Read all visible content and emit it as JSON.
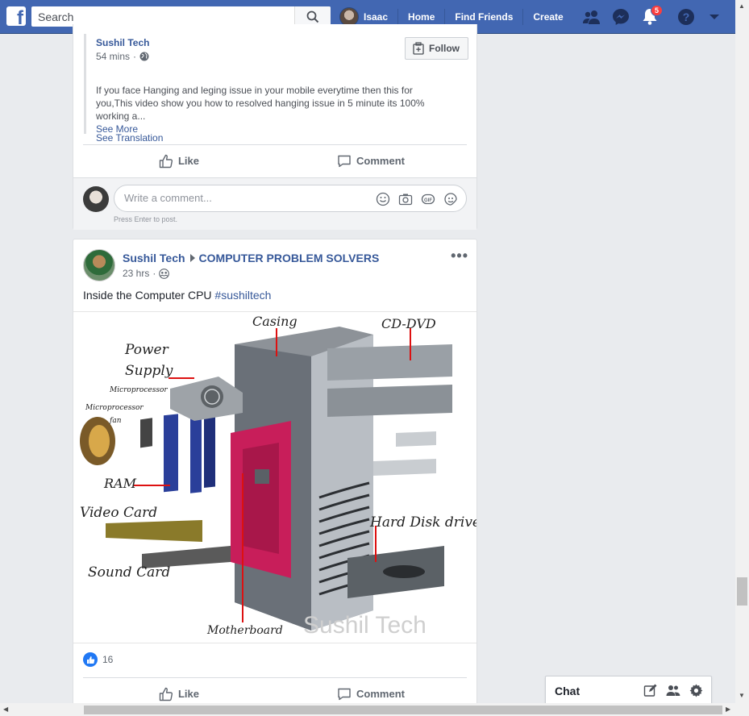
{
  "topbar": {
    "logo": "f",
    "search_placeholder": "Search",
    "user_name": "Isaac",
    "nav_home": "Home",
    "nav_find_friends": "Find Friends",
    "nav_create": "Create",
    "notifications_count": "5",
    "brand_color": "#4267b2"
  },
  "shared_post": {
    "author": "Sushil Tech",
    "time": "54 mins",
    "privacy_icon": "globe-icon",
    "follow_label": "Follow",
    "description": "If you face Hanging and leging issue in your mobile everytime then this for you,This video show you how to resolved hanging issue in 5 minute its 100% working a...",
    "see_more": "See More",
    "see_translation": "See Translation",
    "like_label": "Like",
    "comment_label": "Comment",
    "comment_placeholder": "Write a comment...",
    "press_enter": "Press Enter to post."
  },
  "post": {
    "author": "Sushil Tech",
    "group": "COMPUTER PROBLEM SOLVERS",
    "time": "23 hrs",
    "privacy_icon": "group-icon",
    "text": "Inside the Computer CPU ",
    "hashtag": "#sushiltech",
    "image_labels": {
      "casing": "Casing",
      "cd_dvd": "CD-DVD",
      "power": "Power",
      "supply": "Supply",
      "microprocessor": "Microprocessor",
      "microprocessor2": "Microprocessor",
      "fan": "fan",
      "ram": "RAM",
      "video_card": "Video Card",
      "hard_disk": "Hard Disk drive",
      "sound_card": "Sound Card",
      "motherboard": "Motherboard",
      "watermark": "Sushil Tech"
    },
    "reaction_count": "16",
    "like_label": "Like",
    "comment_label": "Comment"
  },
  "chat": {
    "label": "Chat"
  }
}
